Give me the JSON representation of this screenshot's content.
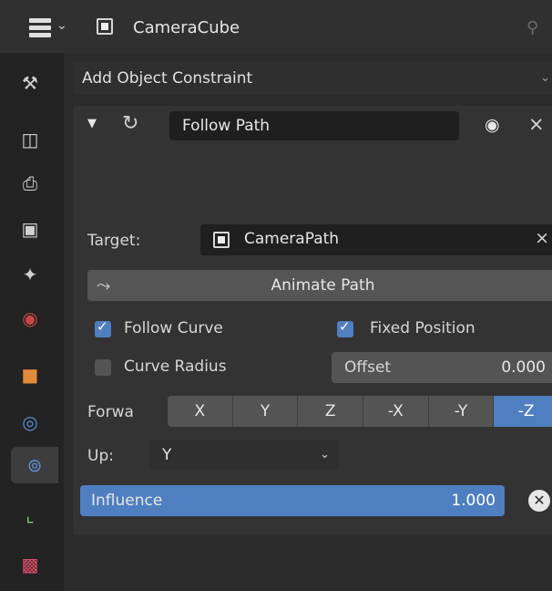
{
  "header": {
    "object_name": "CameraCube"
  },
  "sidebar": {
    "tabs": [
      {
        "name": "tool-icon",
        "glyph": "⚒",
        "color": "#d0d0d0"
      },
      {
        "name": "render-icon",
        "glyph": "📷",
        "color": "#d0d0d0"
      },
      {
        "name": "output-icon",
        "glyph": "🖨",
        "color": "#d0d0d0"
      },
      {
        "name": "view-layer-icon",
        "glyph": "🖼",
        "color": "#d0d0d0"
      },
      {
        "name": "scene-icon",
        "glyph": "✦",
        "color": "#d0d0d0"
      },
      {
        "name": "world-icon",
        "glyph": "◉",
        "color": "#c94848"
      },
      {
        "name": "object-icon",
        "glyph": "■",
        "color": "#e38a3c"
      },
      {
        "name": "modifier-icon",
        "glyph": "◎",
        "color": "#5d8fd8"
      },
      {
        "name": "constraint-icon",
        "glyph": "◎",
        "color": "#5d8fd8"
      },
      {
        "name": "data-icon",
        "glyph": "⌞",
        "color": "#6fd36f"
      },
      {
        "name": "texture-icon",
        "glyph": "▩",
        "color": "#e04f6a"
      }
    ]
  },
  "panel": {
    "add_constraint_label": "Add Object Constraint",
    "constraint": {
      "name": "Follow Path",
      "target_label": "Target:",
      "target_value": "CameraPath",
      "animate_path_label": "Animate Path",
      "follow_curve_label": "Follow Curve",
      "follow_curve_checked": true,
      "fixed_position_label": "Fixed Position",
      "fixed_position_checked": true,
      "curve_radius_label": "Curve Radius",
      "curve_radius_checked": false,
      "offset_label": "Offset",
      "offset_value": "0.000",
      "forward_label": "Forwa",
      "forward_axes": [
        "X",
        "Y",
        "Z",
        "-X",
        "-Y",
        "-Z"
      ],
      "forward_selected": "-Z",
      "up_label": "Up:",
      "up_value": "Y",
      "influence_label": "Influence",
      "influence_value": "1.000",
      "influence_fraction": 1.0
    }
  },
  "colors": {
    "accent": "#4f7fc0",
    "background": "#2b2b2b",
    "field": "#1f1f1f"
  }
}
